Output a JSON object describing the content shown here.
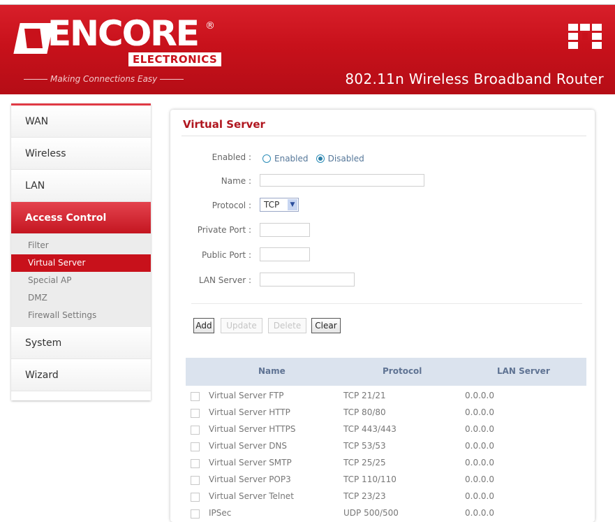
{
  "header": {
    "brand": "ENCORE",
    "brand_sub": "ELECTRONICS",
    "tagline": "Making Connections Easy",
    "product_name": "802.11n Wireless Broadband Router",
    "header_color": "#c8111b"
  },
  "sidebar": {
    "items": [
      {
        "label": "WAN"
      },
      {
        "label": "Wireless"
      },
      {
        "label": "LAN"
      },
      {
        "label": "Access Control",
        "active": true
      },
      {
        "label": "System"
      },
      {
        "label": "Wizard"
      }
    ],
    "subitems": [
      {
        "label": "Filter"
      },
      {
        "label": "Virtual Server",
        "active": true
      },
      {
        "label": "Special AP"
      },
      {
        "label": "DMZ"
      },
      {
        "label": "Firewall Settings"
      }
    ]
  },
  "panel": {
    "title": "Virtual Server",
    "form": {
      "enabled_label": "Enabled :",
      "enabled_option": "Enabled",
      "disabled_option": "Disabled",
      "selected": "Disabled",
      "name_label": "Name :",
      "name_value": "",
      "protocol_label": "Protocol :",
      "protocol_value": "TCP",
      "private_port_label": "Private Port :",
      "private_port_value": "",
      "public_port_label": "Public Port :",
      "public_port_value": "",
      "lan_server_label": "LAN Server :",
      "lan_server_value": ""
    },
    "buttons": {
      "add": "Add",
      "update": "Update",
      "delete": "Delete",
      "clear": "Clear"
    },
    "table": {
      "headers": [
        "Name",
        "Protocol",
        "LAN Server"
      ],
      "rows": [
        {
          "name": "Virtual Server FTP",
          "protocol": "TCP 21/21",
          "lan": "0.0.0.0"
        },
        {
          "name": "Virtual Server HTTP",
          "protocol": "TCP 80/80",
          "lan": "0.0.0.0"
        },
        {
          "name": "Virtual Server HTTPS",
          "protocol": "TCP 443/443",
          "lan": "0.0.0.0"
        },
        {
          "name": "Virtual Server DNS",
          "protocol": "TCP 53/53",
          "lan": "0.0.0.0"
        },
        {
          "name": "Virtual Server SMTP",
          "protocol": "TCP 25/25",
          "lan": "0.0.0.0"
        },
        {
          "name": "Virtual Server POP3",
          "protocol": "TCP 110/110",
          "lan": "0.0.0.0"
        },
        {
          "name": "Virtual Server Telnet",
          "protocol": "TCP 23/23",
          "lan": "0.0.0.0"
        },
        {
          "name": "IPSec",
          "protocol": "UDP 500/500",
          "lan": "0.0.0.0"
        }
      ]
    }
  }
}
